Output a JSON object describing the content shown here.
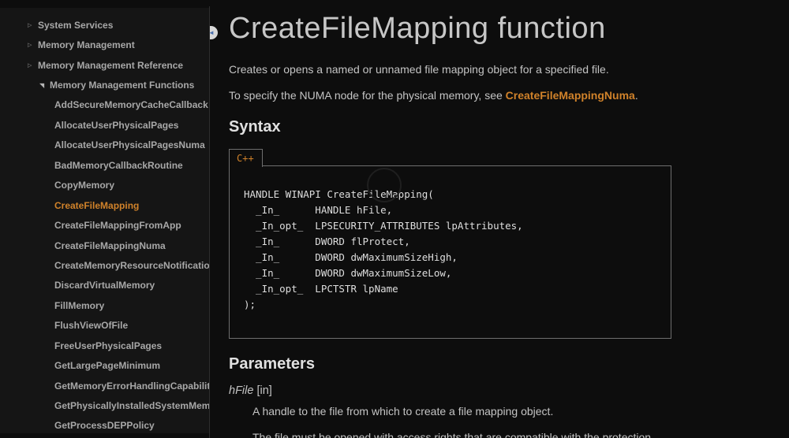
{
  "theme": {
    "page_bg": "#0d0d0d",
    "sidebar_bg": "#151515",
    "divider": "#2e2e2e",
    "sidebar_text": "#a8a8a8",
    "accent_orange": "#d0822a",
    "title_text": "#c7c7c7",
    "body_text": "#c4c4c4",
    "heading_text": "#e0e0e0",
    "code_text": "#dedede",
    "code_border": "#6e6e6e",
    "handle_blue": "#4a6fae"
  },
  "icons": {
    "collapsed_glyph": "▷",
    "expanded_glyph": "◥",
    "handle_arrow_glyph": "◄"
  },
  "sidebar": {
    "top_items": [
      {
        "label": "System Services",
        "state": "collapsed"
      },
      {
        "label": "Memory Management",
        "state": "collapsed"
      },
      {
        "label": "Memory Management Reference",
        "state": "collapsed"
      },
      {
        "label": "Memory Management Functions",
        "state": "expanded"
      }
    ],
    "children": [
      "AddSecureMemoryCacheCallback",
      "AllocateUserPhysicalPages",
      "AllocateUserPhysicalPagesNuma",
      "BadMemoryCallbackRoutine",
      "CopyMemory",
      "CreateFileMapping",
      "CreateFileMappingFromApp",
      "CreateFileMappingNuma",
      "CreateMemoryResourceNotification",
      "DiscardVirtualMemory",
      "FillMemory",
      "FlushViewOfFile",
      "FreeUserPhysicalPages",
      "GetLargePageMinimum",
      "GetMemoryErrorHandlingCapability",
      "GetPhysicallyInstalledSystemMemory",
      "GetProcessDEPPolicy"
    ],
    "selected_item": "CreateFileMapping",
    "selected_index": 5
  },
  "content": {
    "title": "CreateFileMapping function",
    "intro": "Creates or opens a named or unnamed file mapping object for a specified file.",
    "numa_text_before": "To specify the NUMA node for the physical memory, see ",
    "numa_link": "CreateFileMappingNuma",
    "numa_text_after": ".",
    "syntax_heading": "Syntax",
    "code_tab": "C++",
    "code_lines": [
      "HANDLE WINAPI CreateFileMapping(",
      "  _In_      HANDLE hFile,",
      "  _In_opt_  LPSECURITY_ATTRIBUTES lpAttributes,",
      "  _In_      DWORD flProtect,",
      "  _In_      DWORD dwMaximumSizeHigh,",
      "  _In_      DWORD dwMaximumSizeLow,",
      "  _In_opt_  LPCTSTR lpName",
      ");"
    ],
    "parameters_heading": "Parameters",
    "param_name": "hFile",
    "param_annotation": "[in]",
    "param_desc_1": "A handle to the file from which to create a file mapping object.",
    "param_desc_2": "The file must be opened with access rights that are compatible with the protection"
  }
}
